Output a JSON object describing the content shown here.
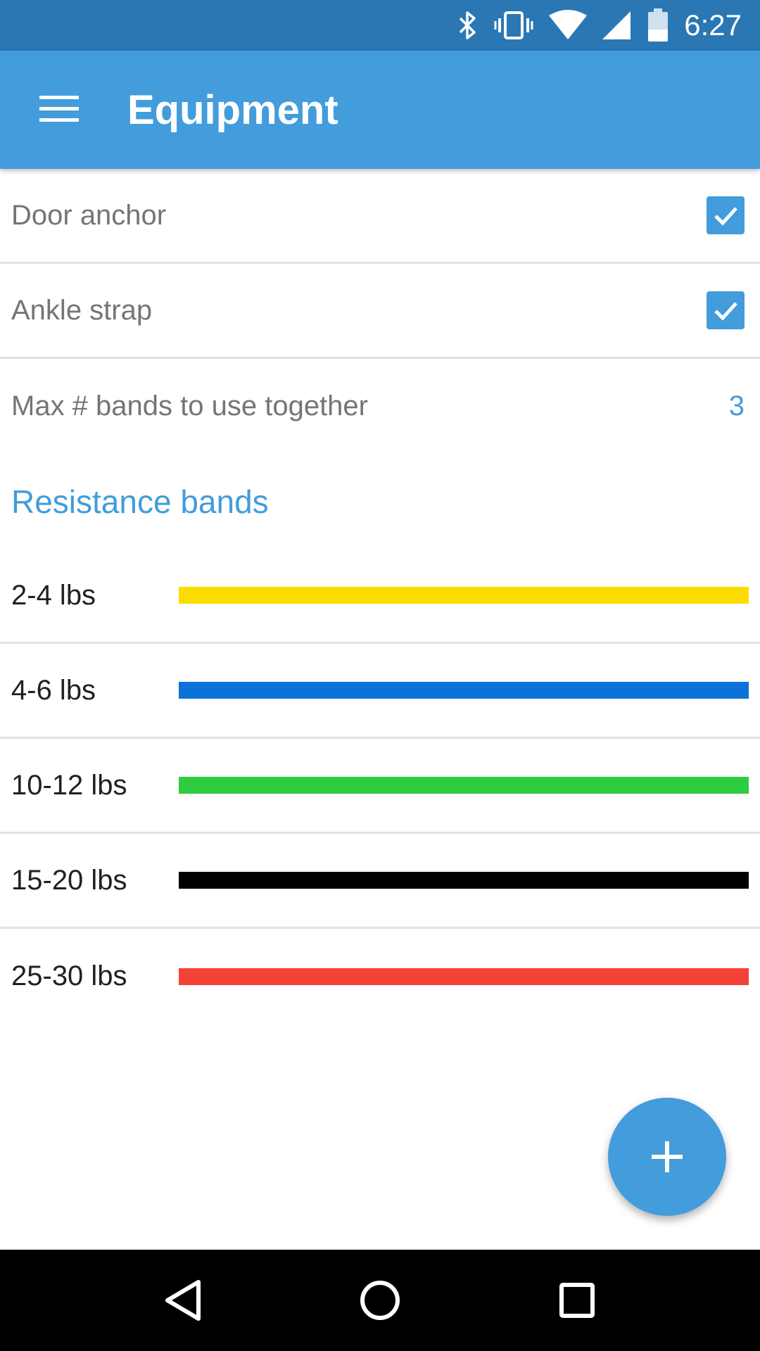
{
  "status_bar": {
    "time": "6:27",
    "icons": [
      "bluetooth-icon",
      "vibrate-icon",
      "wifi-icon",
      "cell-signal-icon",
      "battery-icon"
    ]
  },
  "app_bar": {
    "title": "Equipment",
    "menu_icon": "hamburger-menu-icon"
  },
  "equipment": [
    {
      "label": "Door anchor",
      "checked": true
    },
    {
      "label": "Ankle strap",
      "checked": true
    }
  ],
  "max_bands": {
    "label": "Max # bands to use together",
    "value": "3"
  },
  "resistance": {
    "header": "Resistance bands",
    "bands": [
      {
        "label": "2-4 lbs",
        "color": "#fbdc00"
      },
      {
        "label": "4-6 lbs",
        "color": "#0c72d9"
      },
      {
        "label": "10-12 lbs",
        "color": "#2ecc40"
      },
      {
        "label": "15-20 lbs",
        "color": "#000000"
      },
      {
        "label": "25-30 lbs",
        "color": "#f44336"
      }
    ]
  },
  "fab": {
    "icon": "plus-icon"
  },
  "nav_bar": {
    "icons": [
      "back-icon",
      "home-icon",
      "recents-icon"
    ]
  },
  "colors": {
    "primary": "#439cdb",
    "status_bar": "#2a77b4"
  }
}
